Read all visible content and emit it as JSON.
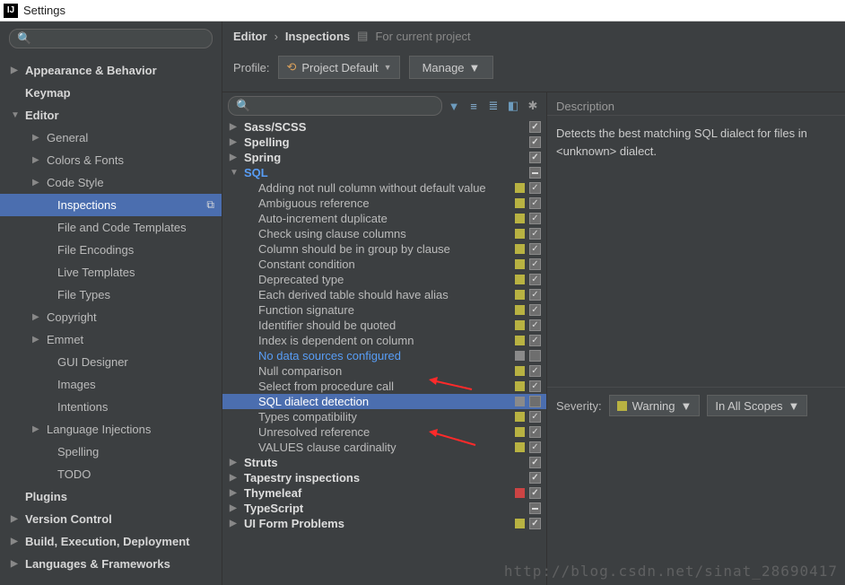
{
  "window": {
    "title": "Settings"
  },
  "breadcrumb": {
    "a": "Editor",
    "b": "Inspections",
    "scope": "For current project"
  },
  "profile": {
    "label": "Profile:",
    "value": "Project Default",
    "manage": "Manage"
  },
  "sidebar": {
    "items": [
      {
        "label": "Appearance & Behavior",
        "level": 1,
        "exp": "▶"
      },
      {
        "label": "Keymap",
        "level": 1,
        "exp": ""
      },
      {
        "label": "Editor",
        "level": 1,
        "exp": "▼"
      },
      {
        "label": "General",
        "level": 2,
        "exp": "▶"
      },
      {
        "label": "Colors & Fonts",
        "level": 2,
        "exp": "▶"
      },
      {
        "label": "Code Style",
        "level": 2,
        "exp": "▶"
      },
      {
        "label": "Inspections",
        "level": 3,
        "exp": "",
        "sel": true,
        "copy": true
      },
      {
        "label": "File and Code Templates",
        "level": 3,
        "exp": ""
      },
      {
        "label": "File Encodings",
        "level": 3,
        "exp": ""
      },
      {
        "label": "Live Templates",
        "level": 3,
        "exp": ""
      },
      {
        "label": "File Types",
        "level": 3,
        "exp": ""
      },
      {
        "label": "Copyright",
        "level": 2,
        "exp": "▶"
      },
      {
        "label": "Emmet",
        "level": 2,
        "exp": "▶"
      },
      {
        "label": "GUI Designer",
        "level": 3,
        "exp": ""
      },
      {
        "label": "Images",
        "level": 3,
        "exp": ""
      },
      {
        "label": "Intentions",
        "level": 3,
        "exp": ""
      },
      {
        "label": "Language Injections",
        "level": 2,
        "exp": "▶"
      },
      {
        "label": "Spelling",
        "level": 3,
        "exp": ""
      },
      {
        "label": "TODO",
        "level": 3,
        "exp": ""
      },
      {
        "label": "Plugins",
        "level": 1,
        "exp": ""
      },
      {
        "label": "Version Control",
        "level": 1,
        "exp": "▶"
      },
      {
        "label": "Build, Execution, Deployment",
        "level": 1,
        "exp": "▶"
      },
      {
        "label": "Languages & Frameworks",
        "level": 1,
        "exp": "▶"
      }
    ]
  },
  "inspections": {
    "rows": [
      {
        "label": "Sass/SCSS",
        "type": "cat",
        "exp": "▶",
        "sev": "",
        "chk": "on"
      },
      {
        "label": "Spelling",
        "type": "cat",
        "exp": "▶",
        "sev": "",
        "chk": "on"
      },
      {
        "label": "Spring",
        "type": "cat",
        "exp": "▶",
        "sev": "",
        "chk": "on"
      },
      {
        "label": "SQL",
        "type": "cat",
        "exp": "▼",
        "sev": "",
        "chk": "mixed",
        "link": true
      },
      {
        "label": "Adding not null column without default value",
        "type": "leaf",
        "sev": "y",
        "chk": "on"
      },
      {
        "label": "Ambiguous reference",
        "type": "leaf",
        "sev": "y",
        "chk": "on"
      },
      {
        "label": "Auto-increment duplicate",
        "type": "leaf",
        "sev": "y",
        "chk": "on"
      },
      {
        "label": "Check using clause columns",
        "type": "leaf",
        "sev": "y",
        "chk": "on"
      },
      {
        "label": "Column should be in group by clause",
        "type": "leaf",
        "sev": "y",
        "chk": "on"
      },
      {
        "label": "Constant condition",
        "type": "leaf",
        "sev": "y",
        "chk": "on"
      },
      {
        "label": "Deprecated type",
        "type": "leaf",
        "sev": "y",
        "chk": "on"
      },
      {
        "label": "Each derived table should have alias",
        "type": "leaf",
        "sev": "y",
        "chk": "on"
      },
      {
        "label": "Function signature",
        "type": "leaf",
        "sev": "y",
        "chk": "on"
      },
      {
        "label": "Identifier should be quoted",
        "type": "leaf",
        "sev": "y",
        "chk": "on"
      },
      {
        "label": "Index is dependent on column",
        "type": "leaf",
        "sev": "y",
        "chk": "on"
      },
      {
        "label": "No data sources configured",
        "type": "leaf",
        "sev": "g",
        "chk": "off",
        "link": true
      },
      {
        "label": "Null comparison",
        "type": "leaf",
        "sev": "y",
        "chk": "on"
      },
      {
        "label": "Select from procedure call",
        "type": "leaf",
        "sev": "y",
        "chk": "on"
      },
      {
        "label": "SQL dialect detection",
        "type": "leaf",
        "sev": "g",
        "chk": "off",
        "sel": true
      },
      {
        "label": "Types compatibility",
        "type": "leaf",
        "sev": "y",
        "chk": "on"
      },
      {
        "label": "Unresolved reference",
        "type": "leaf",
        "sev": "y",
        "chk": "on"
      },
      {
        "label": "VALUES clause cardinality",
        "type": "leaf",
        "sev": "y",
        "chk": "on"
      },
      {
        "label": "Struts",
        "type": "cat",
        "exp": "▶",
        "sev": "",
        "chk": "on"
      },
      {
        "label": "Tapestry inspections",
        "type": "cat",
        "exp": "▶",
        "sev": "",
        "chk": "on"
      },
      {
        "label": "Thymeleaf",
        "type": "cat",
        "exp": "▶",
        "sev": "r",
        "chk": "on"
      },
      {
        "label": "TypeScript",
        "type": "cat",
        "exp": "▶",
        "sev": "",
        "chk": "mixed"
      },
      {
        "label": "UI Form Problems",
        "type": "cat",
        "exp": "▶",
        "sev": "y",
        "chk": "on"
      }
    ]
  },
  "description": {
    "title": "Description",
    "body": "Detects the best matching SQL dialect for files in <unknown> dialect."
  },
  "severity": {
    "label": "Severity:",
    "value": "Warning",
    "scope": "In All Scopes"
  },
  "watermark": "http://blog.csdn.net/sinat_28690417"
}
